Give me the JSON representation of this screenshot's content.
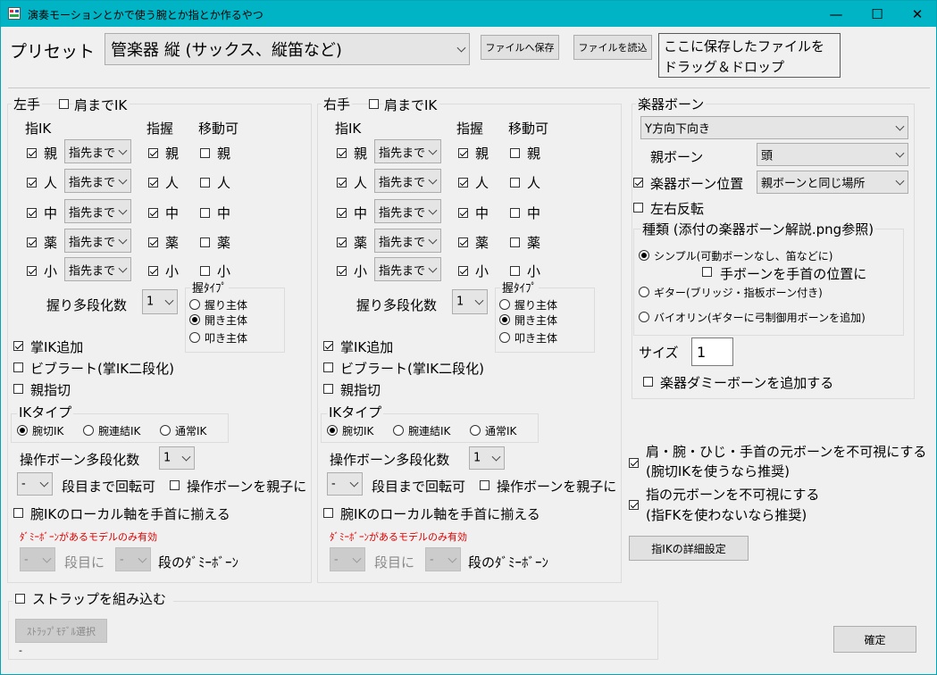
{
  "window": {
    "title": "演奏モーションとかで使う腕とか指とか作るやつ",
    "minimize_glyph": "—",
    "maximize_glyph": "☐",
    "close_glyph": "✕"
  },
  "preset": {
    "label": "プリセット",
    "value": "管楽器 縦 (サックス、縦笛など)",
    "save_button": "ファイルへ保存",
    "load_button": "ファイルを読込",
    "drop_hint_line1": "ここに保存したファイルを",
    "drop_hint_line2": "ドラッグ＆ドロップ"
  },
  "hands": {
    "col_ik": "指IK",
    "col_grip": "指握",
    "col_move": "移動可",
    "shoulder_ik_label": "肩までIK",
    "fingers": [
      "親",
      "人",
      "中",
      "薬",
      "小"
    ],
    "ik_mode": "指先まで",
    "grip_count_label": "握り多段化数",
    "grip_count_value": "1",
    "grip_type_title": "握ﾀｲﾌﾟ",
    "grip_type_options": [
      "握り主体",
      "開き主体",
      "叩き主体"
    ],
    "palm_ik_label": "掌IK追加",
    "vibrato_label": "ビブラート(掌IK二段化)",
    "thumb_cut_label": "親指切",
    "ik_type_title": "IKタイプ",
    "ik_type_options": [
      "腕切IK",
      "腕連結IK",
      "通常IK"
    ],
    "op_bone_count_label": "操作ボーン多段化数",
    "op_bone_count_value": "1",
    "rotate_dropdown_value": "-",
    "rotate_label": "段目まで回転可",
    "op_bone_parent_label": "操作ボーンを親子に",
    "local_axis_label": "腕IKのローカル軸を手首に揃える",
    "dummy_note": "ﾀﾞﾐｰﾎﾞｰﾝがあるモデルのみ有効",
    "dummy_dropdown_value": "-",
    "dummy_mid_label": "段目に",
    "dummy_end_label": "段のﾀﾞﾐｰﾎﾞｰﾝ",
    "left": {
      "title": "左手",
      "shoulder_ik": false,
      "ik_checked": [
        true,
        true,
        true,
        true,
        true
      ],
      "grip_checked": [
        true,
        true,
        true,
        true,
        true
      ],
      "move_checked": [
        false,
        false,
        false,
        false,
        false
      ],
      "grip_type_selected": "開き主体",
      "palm_ik": true,
      "vibrato": false,
      "thumb_cut": false,
      "ik_type_selected": "腕切IK",
      "op_bone_parent": false,
      "local_axis": false
    },
    "right": {
      "title": "右手",
      "shoulder_ik": false,
      "ik_checked": [
        true,
        true,
        true,
        true,
        true
      ],
      "grip_checked": [
        true,
        true,
        true,
        true,
        true
      ],
      "move_checked": [
        false,
        false,
        false,
        false,
        false
      ],
      "grip_type_selected": "開き主体",
      "palm_ik": true,
      "vibrato": false,
      "thumb_cut": false,
      "ik_type_selected": "腕切IK",
      "op_bone_parent": false,
      "local_axis": false
    }
  },
  "instrument": {
    "title": "楽器ボーン",
    "direction_value": "Y方向下向き",
    "parent_bone_label": "親ボーン",
    "parent_bone_value": "頭",
    "position_label": "楽器ボーン位置",
    "position_checked": true,
    "position_value": "親ボーンと同じ場所",
    "mirror_label": "左右反転",
    "mirror_checked": false,
    "kind_title": "種類 (添付の楽器ボーン解説.png参照)",
    "kind_options": [
      "シンプル(可動ボーンなし、笛などに)",
      "ギター(ブリッジ・指板ボーン付き)",
      "バイオリン(ギターに弓制御用ボーンを追加)"
    ],
    "kind_selected": "シンプル(可動ボーンなし、笛などに)",
    "hand_bone_wrist_label": "手ボーンを手首の位置に",
    "hand_bone_wrist_checked": false,
    "size_label": "サイズ",
    "size_value": "1",
    "dummy_bone_label": "楽器ダミーボーンを追加する",
    "dummy_bone_checked": false
  },
  "options": {
    "hide_arm_line1": "肩・腕・ひじ・手首の元ボーンを不可視にする",
    "hide_arm_line2": "(腕切IKを使うなら推奨)",
    "hide_arm_checked": true,
    "hide_finger_line1": "指の元ボーンを不可視にする",
    "hide_finger_line2": "(指FKを使わないなら推奨)",
    "hide_finger_checked": true,
    "finger_ik_detail_button": "指IKの詳細設定",
    "confirm_button": "確定"
  },
  "strap": {
    "label": "ストラップを組み込む",
    "checked": false,
    "model_button": "ｽﾄﾗｯﾌﾟﾓﾃﾞﾙ選択",
    "model_value": "-"
  }
}
